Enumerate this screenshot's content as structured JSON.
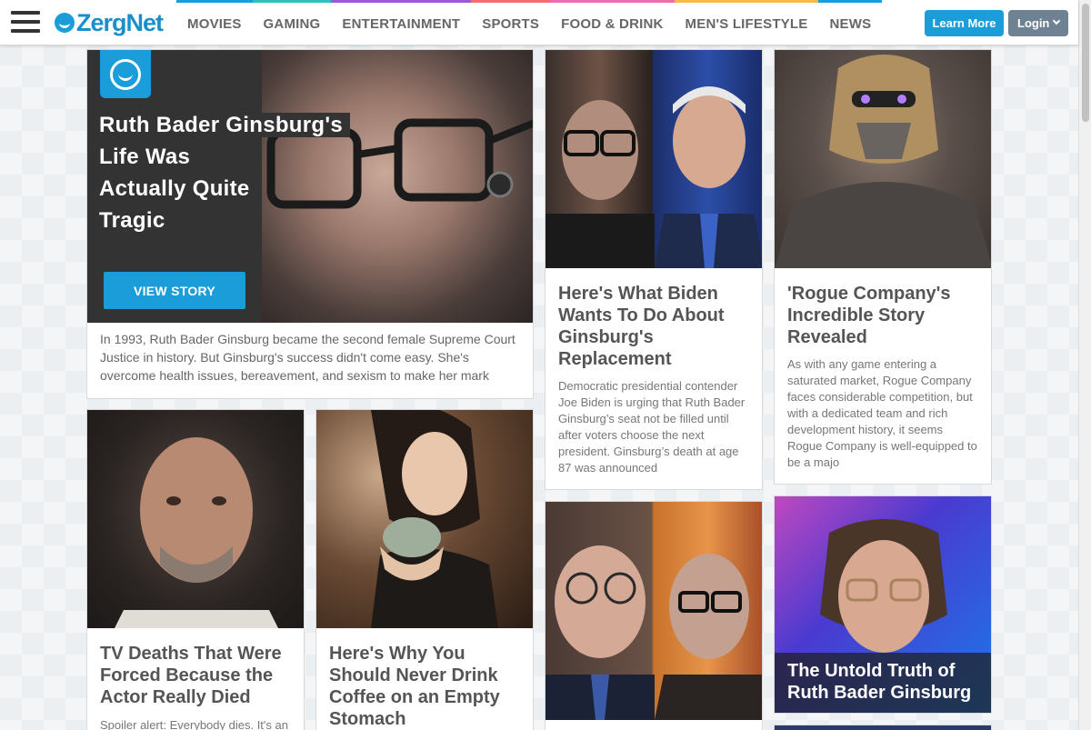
{
  "header": {
    "logo_text": "ZergNet",
    "nav": [
      {
        "label": "MOVIES",
        "color": "#1a9dd9"
      },
      {
        "label": "GAMING",
        "color": "#2bc1c1"
      },
      {
        "label": "ENTERTAINMENT",
        "color": "#9b59d6"
      },
      {
        "label": "SPORTS",
        "color": "#f26f6f"
      },
      {
        "label": "FOOD & DRINK",
        "color": "#e86fb0"
      },
      {
        "label": "MEN'S LIFESTYLE",
        "color": "#f5b84a"
      },
      {
        "label": "NEWS",
        "color": "#1a9dd9"
      }
    ],
    "learn_more": "Learn More",
    "login": "Login"
  },
  "featured": {
    "title_lines": [
      "Ruth Bader Ginsburg's",
      "Life Was",
      "Actually Quite",
      "Tragic"
    ],
    "button": "VIEW STORY",
    "description": "In 1993, Ruth Bader Ginsburg became the second female Supreme Court Justice in history. But Ginsburg's success didn't come easy. She's overcome health issues, bereavement, and sexism to make her mark"
  },
  "cards": {
    "biden": {
      "title": "Here's What Biden Wants To Do About Ginsburg's Replacement",
      "description": "Democratic presidential contender Joe Biden is urging that Ruth Bader Ginsburg’s seat not be filled until after voters choose the next president. Ginsburg’s death at age 87 was announced"
    },
    "rogue": {
      "title": "'Rogue Company's Incredible Story Revealed",
      "description": "As with any game entering a saturated market, Rogue Company faces considerable competition, but with a dedicated team and rich development history, it seems Rogue Company is well-equipped to be a majo"
    },
    "tv_deaths": {
      "title": "TV Deaths That Were Forced Because the Actor Really Died",
      "description": "Spoiler alert: Everybody dies. It's an"
    },
    "coffee": {
      "title": "Here's Why You Should Never Drink Coffee on an Empty Stomach"
    },
    "untold": {
      "title": "The Untold Truth of Ruth Bader Ginsburg"
    }
  }
}
